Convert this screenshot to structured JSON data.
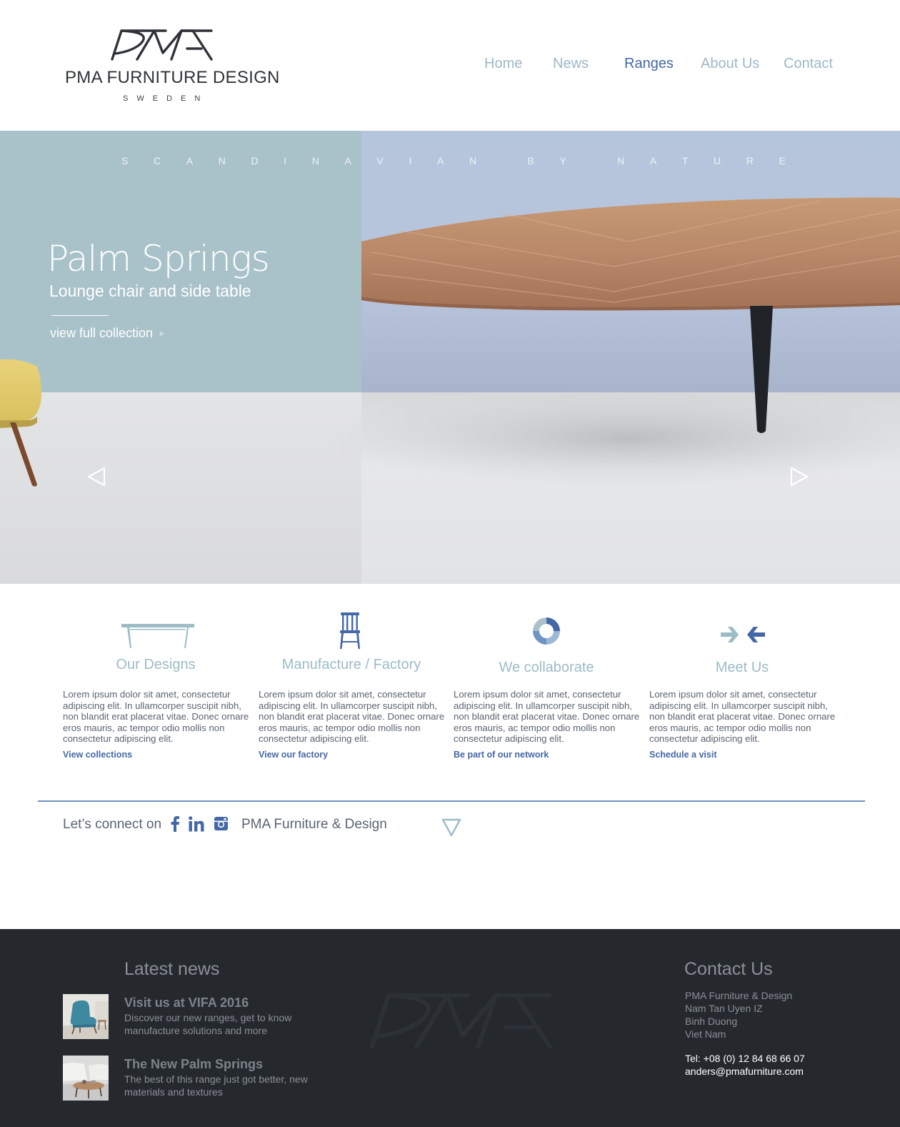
{
  "brand": {
    "name": "PMA FURNITURE DESIGN",
    "country": "SWEDEN",
    "logo_icon": "pma-monogram-logo"
  },
  "nav": {
    "items": [
      {
        "label": "Home"
      },
      {
        "label": "News"
      },
      {
        "label": "Ranges"
      },
      {
        "label": "About Us"
      },
      {
        "label": "Contact"
      }
    ],
    "active": "Ranges",
    "colors": {
      "default": "#9db8c8",
      "active": "#4468a6"
    }
  },
  "hero": {
    "tagline_words": [
      "S",
      "C",
      "A",
      "N",
      "D",
      "I",
      "N",
      "A",
      "V",
      "I",
      "A",
      "N",
      "",
      "B",
      "Y",
      "",
      "N",
      "A",
      "T",
      "U",
      "R",
      "E"
    ],
    "title": "Palm Springs",
    "subtitle": "Lounge chair and side table",
    "link_label": "view full collection",
    "link_arrow": "▹",
    "prev_icon": "left-triangle-arrow-icon",
    "next_icon": "right-triangle-arrow-icon"
  },
  "features": [
    {
      "icon": "table-icon",
      "title": "Our Designs",
      "body": "Lorem ipsum dolor sit amet, consectetur adipiscing elit. In ullamcorper suscipit nibh, non blandit erat placerat vitae. Donec ornare eros mauris, ac tempor odio mollis non consectetur adipiscing elit.",
      "link": "View collections"
    },
    {
      "icon": "chair-icon",
      "title": "Manufacture / Factory",
      "body": "Lorem ipsum dolor sit amet, consectetur adipiscing elit. In ullamcorper suscipit nibh, non blandit erat placerat vitae. Donec ornare eros mauris, ac tempor odio mollis non consectetur adipiscing elit.",
      "link": "View our factory"
    },
    {
      "icon": "ring-icon",
      "title": "We collaborate",
      "body": "Lorem ipsum dolor sit amet, consectetur adipiscing elit. In ullamcorper suscipit nibh, non blandit erat placerat vitae. Donec ornare eros mauris, ac tempor odio mollis non consectetur adipiscing elit.",
      "link": "Be part of our network"
    },
    {
      "icon": "converging-arrows-icon",
      "title": "Meet Us",
      "body": "Lorem ipsum dolor sit amet, consectetur adipiscing elit. In ullamcorper suscipit nibh, non blandit erat placerat vitae. Donec ornare eros mauris, ac tempor odio mollis non consectetur adipiscing elit.",
      "link": "Schedule a visit"
    }
  ],
  "social": {
    "lead": "Let’s connect on",
    "icons": [
      "facebook-icon",
      "linkedin-icon",
      "instagram-icon"
    ],
    "handle": "PMA Furniture & Design",
    "scroll_icon": "down-triangle-icon"
  },
  "footer": {
    "news_heading": "Latest news",
    "news": [
      {
        "title": "Visit us at VIFA 2016",
        "desc": "Discover our new ranges, get to know manufacture solutions and more"
      },
      {
        "title": "The New Palm Springs",
        "desc": "The best of this range just got better, new materials and textures"
      }
    ],
    "contact_heading": "Contact Us",
    "address": [
      "PMA Furniture & Design",
      "Nam Tan Uyen IZ",
      "Binh Duong",
      "Viet Nam"
    ],
    "tel": "Tel: +08 (0) 12 84 68 66 07",
    "email": "anders@pmafurniture.com"
  },
  "colors": {
    "accent": "#4468a6",
    "muted_blue": "#9dbcc6",
    "hero_left": "#a9c2c9",
    "hero_right": "#b5c5db",
    "footer_bg": "#25292e"
  }
}
